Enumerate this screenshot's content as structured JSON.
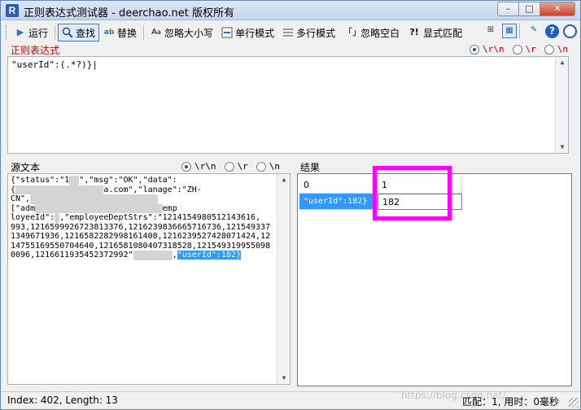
{
  "window": {
    "title": "正则表达式测试器 - deerchao.net 版权所有",
    "app_icon_letter": "R",
    "minimize": "–",
    "maximize": "□",
    "close": "✕"
  },
  "toolbar": {
    "run": "运行",
    "find": "查找",
    "replace": "替换",
    "ignore_case": "忽略大小写",
    "single_line": "单行模式",
    "multi_line": "多行模式",
    "ignore_whitespace": "忽略空白",
    "explicit_capture": "显式匹配",
    "ignore_ws_icon": "「」",
    "explicit_icon": "?!"
  },
  "regex": {
    "label": "正则表达式",
    "value": "\"userId\":(.*?)}|",
    "newline_options": [
      "\\r\\n",
      "\\r",
      "\\n"
    ],
    "selected_newline": 0
  },
  "source": {
    "label": "源文本",
    "newline_options": [
      "\\r\\n",
      "\\r",
      "\\n"
    ],
    "selected_newline": 0,
    "lines": [
      {
        "pre": "{\"status\":\"1",
        "blur": "  ",
        "post": "\",\"msg\":\"OK\",\"data\":"
      },
      {
        "pre": "{",
        "blur": "                  ",
        "post": "a.com\",\"lanage\":\"ZH-"
      },
      {
        "pre": "CN\",",
        "blur": "                          ",
        "post": ""
      },
      {
        "pre": "[\"adm",
        "blur": "                          ",
        "post": "emp"
      },
      {
        "pre": "loyeeId\":",
        "blur": " ",
        "post": ",\"employeeDeptStrs\":\"1214154980512143616,"
      },
      {
        "pre": "993,1216599926723813376,1216239836665716736,121549337",
        "blur": "",
        "post": ""
      },
      {
        "pre": "1349671936,1216582282998161408,1216239527428071424,12",
        "blur": "",
        "post": ""
      },
      {
        "pre": "14755169550704640,1216581080407318528,121549319955098",
        "blur": "",
        "post": ""
      },
      {
        "pre": "0096,1216611935452372992\"",
        "blur": "        ",
        "post": ",",
        "selected": "\"userId\":182}"
      }
    ]
  },
  "result": {
    "label": "结果",
    "headers": [
      "0",
      "1"
    ],
    "rows": [
      [
        "\"userId\":182}",
        "182"
      ]
    ]
  },
  "status": {
    "left": "Index: 402, Length: 13",
    "right": "匹配：1, 用时：0毫秒",
    "watermark": "https://blog.csdn.net/..."
  },
  "colors": {
    "highlight": "#ff00ff",
    "selection": "#3399ff",
    "regex_label": "#d00000"
  }
}
